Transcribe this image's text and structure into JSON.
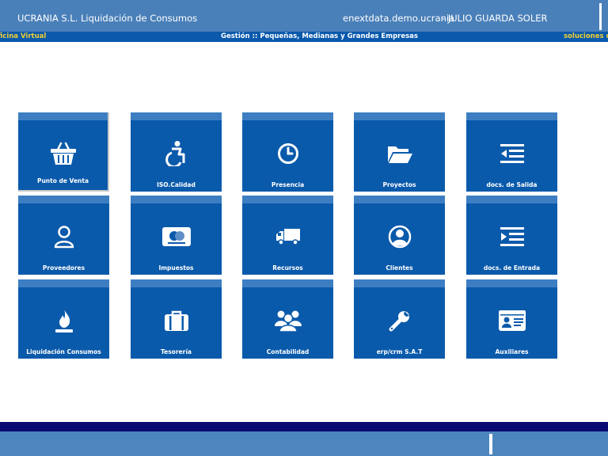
{
  "header": {
    "title": "UCRANIA S.L. Liquidación de Consumos",
    "host": "enextdata.demo.ucrania",
    "user": "- JULIO GUARDA SOLER"
  },
  "subheader": {
    "left": "ficina Virtual",
    "center": "Gestión :: Pequeñas, Medianas y Grandes Empresas",
    "right": "soluciones de"
  },
  "tiles": [
    {
      "label": "Punto de Venta",
      "icon": "basket-icon"
    },
    {
      "label": "ISO.Calidad",
      "icon": "accessibility-icon"
    },
    {
      "label": "Presencia",
      "icon": "clock-icon"
    },
    {
      "label": "Proyectos",
      "icon": "folder-open-icon"
    },
    {
      "label": "docs. de Salida",
      "icon": "outdent-icon"
    },
    {
      "label": "Proveedores",
      "icon": "user-outline-icon"
    },
    {
      "label": "Impuestos",
      "icon": "credit-card-icon"
    },
    {
      "label": "Recursos",
      "icon": "truck-icon"
    },
    {
      "label": "Clientes",
      "icon": "user-circle-icon"
    },
    {
      "label": "docs. de Entrada",
      "icon": "indent-icon"
    },
    {
      "label": "Liquidación Consumos",
      "icon": "fire-icon"
    },
    {
      "label": "Tesorería",
      "icon": "briefcase-icon"
    },
    {
      "label": "Contabilidad",
      "icon": "users-icon"
    },
    {
      "label": "erp/crm S.A.T",
      "icon": "wrench-icon"
    },
    {
      "label": "Auxiliares",
      "icon": "id-card-icon"
    }
  ],
  "colors": {
    "header_bg": "#4a80b9",
    "subheader_bg": "#0a59ac",
    "tile_bg": "#0a5aab",
    "tile_strip": "#3d7ec2",
    "accent_yellow": "#f2cf33",
    "footer_dark": "#0a0a72",
    "footer_bg": "#4d86bd"
  }
}
